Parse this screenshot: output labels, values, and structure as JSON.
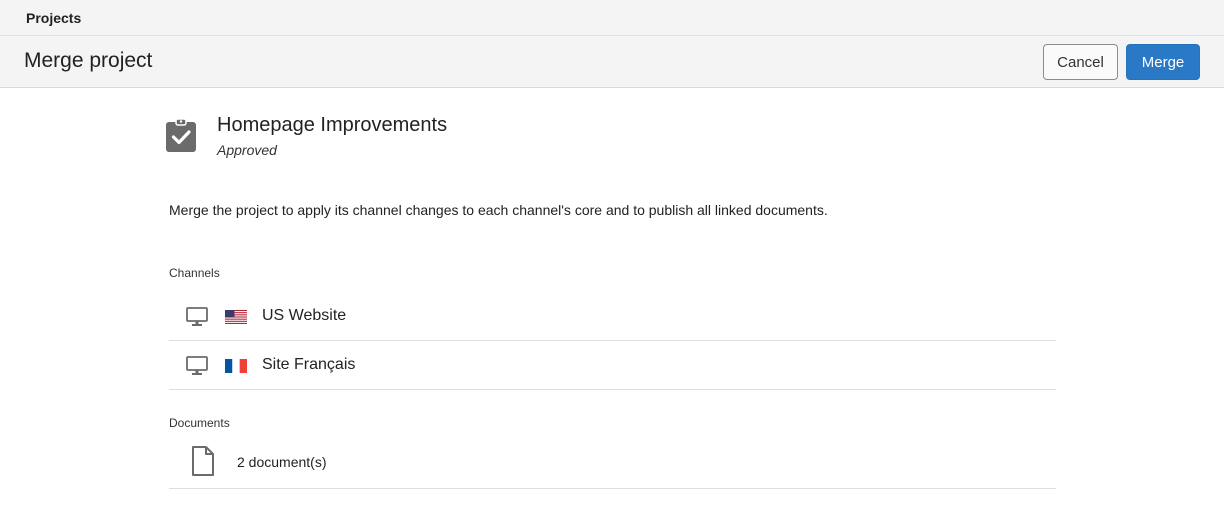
{
  "breadcrumb": {
    "label": "Projects"
  },
  "header": {
    "title": "Merge project",
    "cancel_label": "Cancel",
    "merge_label": "Merge"
  },
  "project": {
    "icon": "clipboard-check-icon",
    "name": "Homepage Improvements",
    "status": "Approved"
  },
  "description": "Merge the project to apply its channel changes to each channel's core and to publish all linked documents.",
  "channels": {
    "label": "Channels",
    "items": [
      {
        "name": "US Website",
        "icon": "monitor-icon",
        "flag": "us-flag-icon"
      },
      {
        "name": "Site Français",
        "icon": "monitor-icon",
        "flag": "fr-flag-icon"
      }
    ]
  },
  "documents": {
    "label": "Documents",
    "icon": "document-icon",
    "summary": "2 document(s)"
  },
  "colors": {
    "primary": "#2979c6",
    "header_bg": "#f4f4f4",
    "icon_gray": "#6b6b6b"
  }
}
